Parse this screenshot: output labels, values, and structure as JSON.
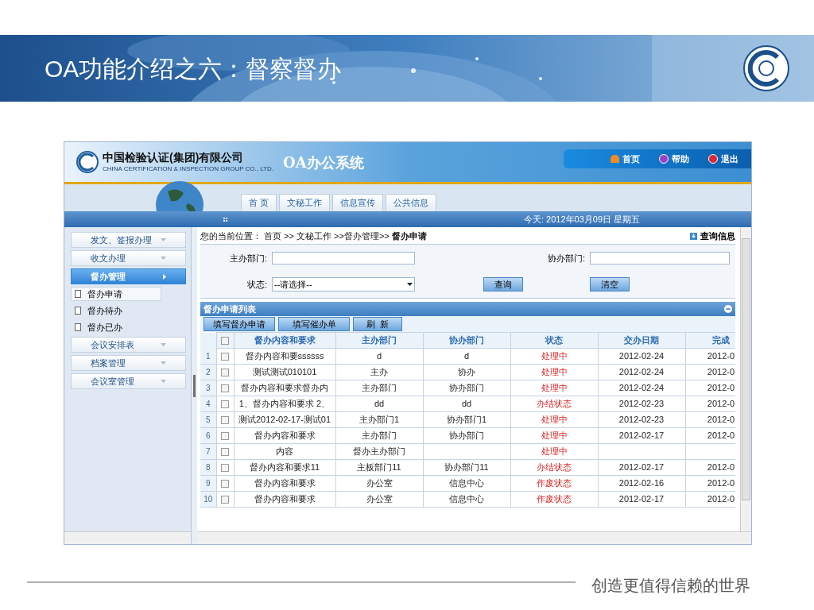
{
  "slide": {
    "title": "OA功能介绍之六：督察督办",
    "footer": "创造更值得信赖的世界"
  },
  "app": {
    "company_cn": "中国检验认证(集团)有限公司",
    "company_en": "CHINA CERTIFICATION & INSPECTION GROUP CO., LTD.",
    "system_name": "OA办公系统",
    "top_links": [
      {
        "label": "首页",
        "kind": "home"
      },
      {
        "label": "帮助",
        "kind": "help"
      },
      {
        "label": "退出",
        "kind": "exit"
      }
    ],
    "tabs": [
      {
        "label": "首 页",
        "selected": false
      },
      {
        "label": "文秘工作",
        "selected": false
      },
      {
        "label": "信息宣传",
        "selected": false
      },
      {
        "label": "公共信息",
        "selected": false
      }
    ],
    "date": "今天: 2012年03月09日 星期五",
    "sidebar": [
      {
        "label": "发文、签报办理",
        "selected": false,
        "expanded": false
      },
      {
        "label": "收文办理",
        "selected": false,
        "expanded": false
      },
      {
        "label": "督办管理",
        "selected": true,
        "expanded": true,
        "children": [
          {
            "label": "督办申请",
            "selected": true
          },
          {
            "label": "督办待办",
            "selected": false
          },
          {
            "label": "督办已办",
            "selected": false
          }
        ]
      },
      {
        "label": "会议安排表",
        "selected": false,
        "expanded": false
      },
      {
        "label": "档案管理",
        "selected": false,
        "expanded": false
      },
      {
        "label": "会议室管理",
        "selected": false,
        "expanded": false
      }
    ],
    "breadcrumb": "您的当前位置： 首页 >> 文秘工作 >>督办管理>> **督办申请**",
    "query_link": "查询信息",
    "form": {
      "main_dept_label": "主办部门:",
      "assist_dept_label": "协办部门:",
      "status_label": "状态:",
      "status_value": "--请选择--",
      "query_button": "查询",
      "clear_button": "清空"
    },
    "list": {
      "title": "督办申请列表",
      "select_all_checked": false,
      "buttons": [
        "填写督办申请",
        "填写催办单",
        "刷  新"
      ],
      "columns": [
        "督办内容和要求",
        "主办部门",
        "协办部门",
        "状态",
        "交办日期",
        "完成"
      ],
      "rows": [
        {
          "no": "1",
          "checked": false,
          "cells": [
            "督办内容和要ssssss",
            "d",
            "d",
            "处理中",
            "2012-02-24",
            "2012-0"
          ]
        },
        {
          "no": "2",
          "checked": false,
          "cells": [
            "测试测试010101",
            "主办",
            "协办",
            "处理中",
            "2012-02-24",
            "2012-0"
          ]
        },
        {
          "no": "3",
          "checked": false,
          "cells": [
            "督办内容和要求督办内",
            "主办部门",
            "协办部门",
            "处理中",
            "2012-02-24",
            "2012-0"
          ]
        },
        {
          "no": "4",
          "checked": false,
          "cells": [
            "1、督办内容和要求 2、",
            "dd",
            "dd",
            "办结状态",
            "2012-02-23",
            "2012-0"
          ]
        },
        {
          "no": "5",
          "checked": false,
          "cells": [
            "测试2012-02-17-测试01",
            "主办部门1",
            "协办部门1",
            "处理中",
            "2012-02-23",
            "2012-0"
          ]
        },
        {
          "no": "6",
          "checked": false,
          "cells": [
            "督办内容和要求",
            "主办部门",
            "协办部门",
            "处理中",
            "2012-02-17",
            "2012-0"
          ]
        },
        {
          "no": "7",
          "checked": false,
          "cells": [
            "内容",
            "督办主办部门",
            "",
            "处理中",
            "",
            ""
          ]
        },
        {
          "no": "8",
          "checked": false,
          "cells": [
            "督办内容和要求11",
            "主板部门11",
            "协办部门11",
            "办结状态",
            "2012-02-17",
            "2012-0"
          ]
        },
        {
          "no": "9",
          "checked": false,
          "cells": [
            "督办内容和要求",
            "办公室",
            "信息中心",
            "作废状态",
            "2012-02-16",
            "2012-0"
          ]
        },
        {
          "no": "10",
          "checked": false,
          "cells": [
            "督办内容和要求",
            "办公室",
            "信息中心",
            "作废状态",
            "2012-02-17",
            "2012-0"
          ]
        }
      ]
    }
  }
}
